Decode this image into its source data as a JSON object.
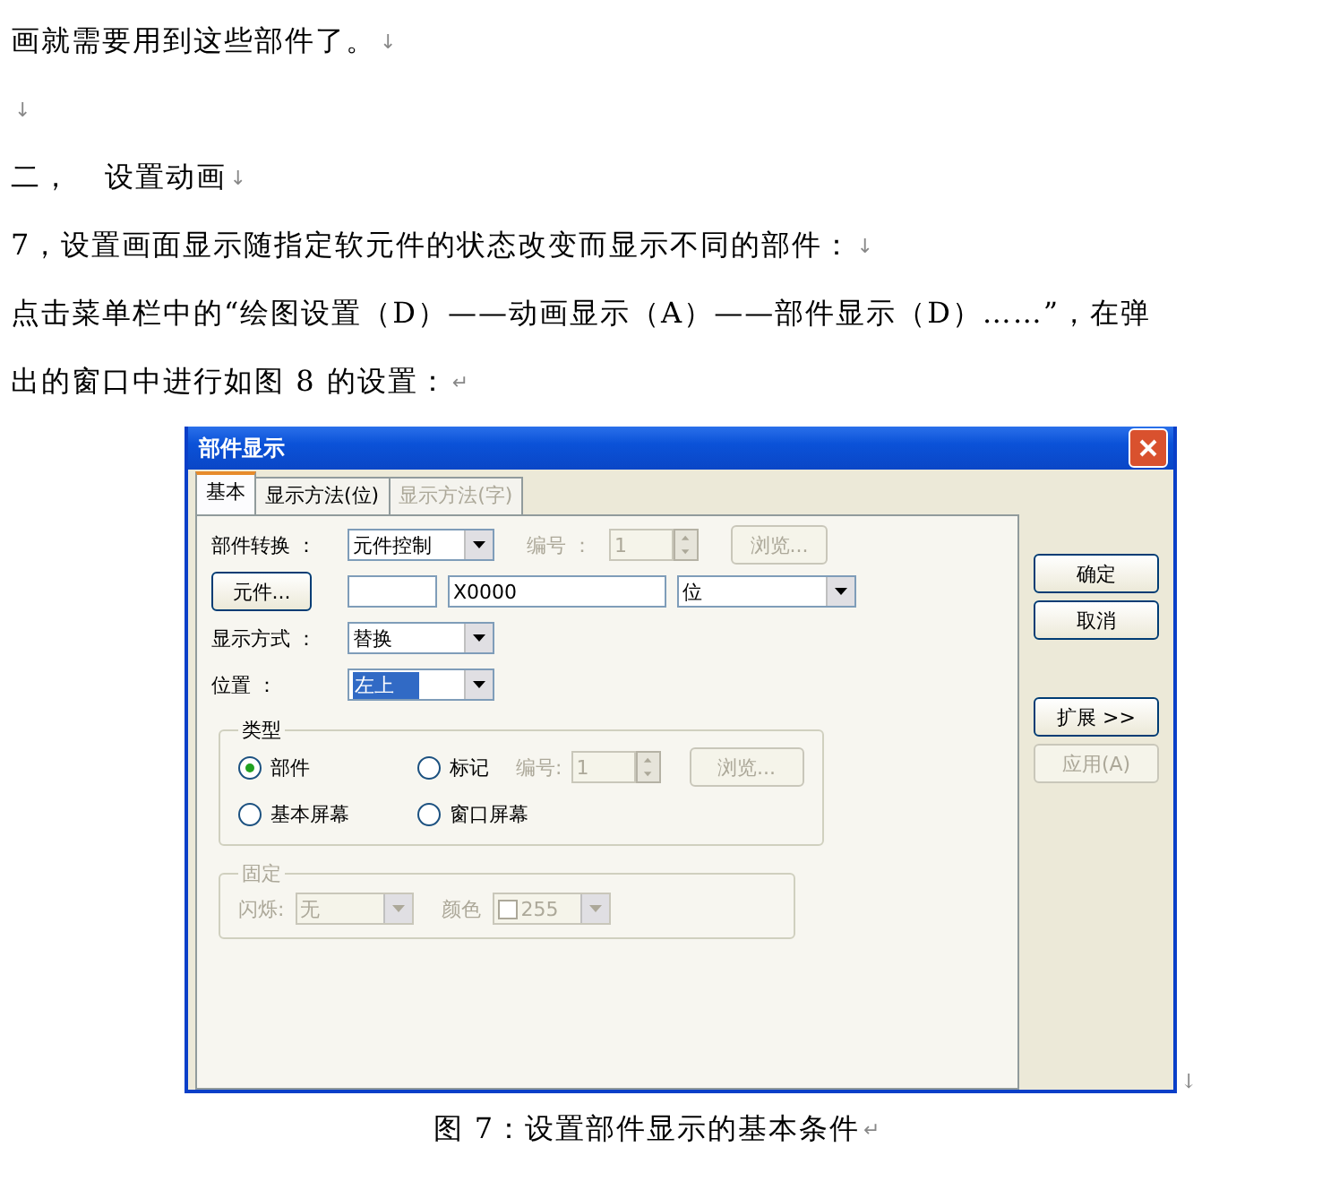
{
  "document": {
    "lines": [
      {
        "text": "画就需要用到这些部件了。",
        "mark": "↓"
      },
      {
        "mark": "↓"
      },
      {
        "text": "二，   设置动画",
        "mark": "↓"
      },
      {
        "text": "7，设置画面显示随指定软元件的状态改变而显示不同的部件：",
        "mark": "↓"
      },
      {
        "text": "点击菜单栏中的“绘图设置（D）——动画显示（A）——部件显示（D）……”，在弹"
      },
      {
        "text": "出的窗口中进行如图 8 的设置：",
        "mark": "↵"
      }
    ],
    "figure_mark": "↓",
    "caption": {
      "text": "图 7：设置部件显示的基本条件",
      "mark": "↵"
    }
  },
  "dialog": {
    "title": "部件显示",
    "tabs": [
      {
        "label": "基本",
        "selected": true,
        "disabled": false
      },
      {
        "label": "显示方法(位)",
        "selected": false,
        "disabled": false
      },
      {
        "label": "显示方法(字)",
        "selected": false,
        "disabled": true
      }
    ],
    "component_switch": {
      "label": "部件转换 ：",
      "value": "元件控制"
    },
    "number": {
      "label": "编号 ：",
      "value": "1",
      "disabled": true
    },
    "browse": {
      "label": "浏览...",
      "disabled": true
    },
    "device_button": {
      "label": "元件..."
    },
    "device_address": {
      "value": "X0000"
    },
    "device_type": {
      "value": "位"
    },
    "display_mode": {
      "label": "显示方式 ：",
      "value": "替换"
    },
    "position": {
      "label": "位置 ：",
      "value": "左上",
      "focused": true
    },
    "type_group": {
      "title": "类型",
      "options": [
        {
          "label": "部件",
          "selected": true
        },
        {
          "label": "标记",
          "selected": false
        },
        {
          "label": "基本屏幕",
          "selected": false
        },
        {
          "label": "窗口屏幕",
          "selected": false
        }
      ],
      "number": {
        "label": "编号:",
        "value": "1",
        "disabled": true
      },
      "browse": {
        "label": "浏览...",
        "disabled": true
      }
    },
    "fixed_group": {
      "title": "固定",
      "disabled": true,
      "blink": {
        "label": "闪烁:",
        "value": "无"
      },
      "color": {
        "label": "颜色",
        "value": "255"
      }
    },
    "buttons": [
      {
        "label": "确定",
        "disabled": false
      },
      {
        "label": "取消",
        "disabled": false
      },
      {
        "label": "扩展 >>",
        "disabled": false
      },
      {
        "label": "应用(A)",
        "disabled": true
      }
    ]
  }
}
